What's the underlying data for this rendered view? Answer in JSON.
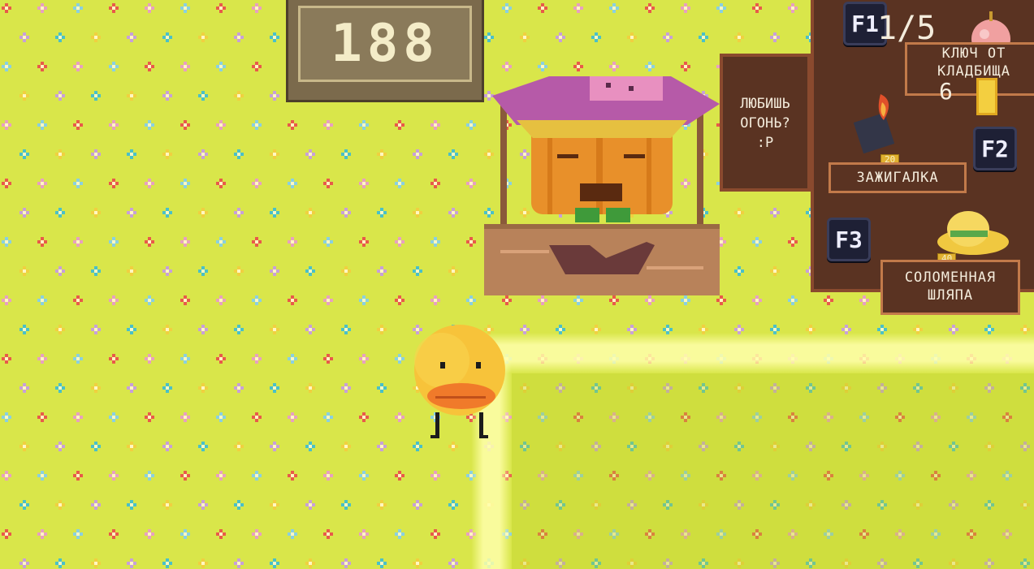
{
  "hud": {
    "score": "188"
  },
  "sign": {
    "line1": "ЛЮБИШЬ",
    "line2": "ОГОНЬ?",
    "line3": ":Р"
  },
  "shop": {
    "slots": [
      {
        "key": "F1",
        "counter": "1/5",
        "name_line1": "КЛЮЧ ОТ",
        "name_line2": "КЛАДБИЩА",
        "price": "6",
        "icon": "peach-icon"
      },
      {
        "key": "F2",
        "name_line1": "ЗАЖИГАЛКА",
        "name_line2": "",
        "price": "20",
        "icon": "lighter-icon"
      },
      {
        "key": "F3",
        "name_line1": "СОЛОМЕННАЯ",
        "name_line2": "ШЛЯПА",
        "price": "40",
        "icon": "straw-hat-icon"
      }
    ]
  },
  "colors": {
    "grass": "#d9e64a",
    "panel": "#5a3322",
    "panel_border": "#8a4a2e",
    "key_bg": "#1e2035",
    "duck": "#f7c33a",
    "beak": "#f07a2a",
    "pumpkin": "#e8902a"
  }
}
